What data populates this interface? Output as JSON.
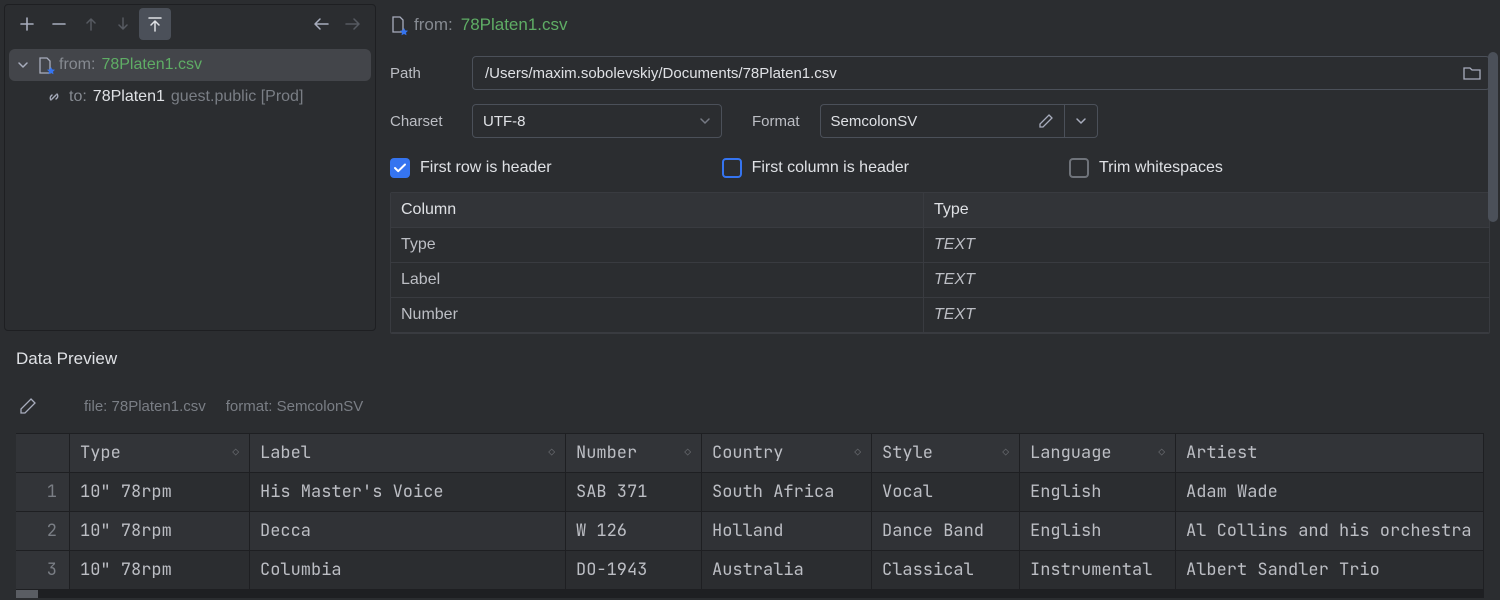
{
  "source": {
    "prefix": "from:",
    "filename": "78Platen1.csv"
  },
  "target": {
    "prefix": "to:",
    "name": "78Platen1",
    "suffix": "guest.public [Prod]"
  },
  "form": {
    "path_label": "Path",
    "path_value": "/Users/maxim.sobolevskiy/Documents/78Platen1.csv",
    "charset_label": "Charset",
    "charset_value": "UTF-8",
    "format_label": "Format",
    "format_value": "SemcolonSV"
  },
  "checks": {
    "first_row": "First row is header",
    "first_col": "First column is header",
    "trim": "Trim whitespaces"
  },
  "columns_table": {
    "head_col": "Column",
    "head_type": "Type",
    "rows": [
      {
        "name": "Type",
        "type": "TEXT"
      },
      {
        "name": "Label",
        "type": "TEXT"
      },
      {
        "name": "Number",
        "type": "TEXT"
      }
    ]
  },
  "preview": {
    "title": "Data Preview",
    "file_label": "file: 78Platen1.csv",
    "format_label": "format: SemcolonSV",
    "headers": [
      "Type",
      "Label",
      "Number",
      "Country",
      "Style",
      "Language",
      "Artiest"
    ],
    "rows": [
      {
        "n": "1",
        "cells": [
          "10\" 78rpm",
          "His Master's Voice",
          "SAB 371",
          "South Africa",
          "Vocal",
          "English",
          "Adam Wade"
        ]
      },
      {
        "n": "2",
        "cells": [
          "10\" 78rpm",
          "Decca",
          "W 126",
          "Holland",
          "Dance Band",
          "English",
          "Al Collins and his orchestra"
        ]
      },
      {
        "n": "3",
        "cells": [
          "10\" 78rpm",
          "Columbia",
          "DO-1943",
          "Australia",
          "Classical",
          "Instrumental",
          "Albert Sandler Trio"
        ]
      }
    ]
  }
}
